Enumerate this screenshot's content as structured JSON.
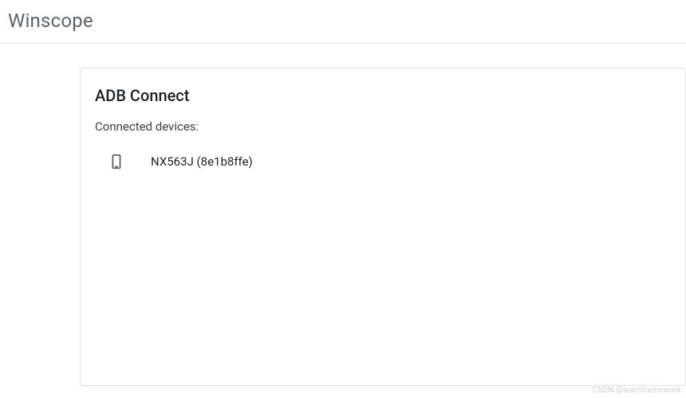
{
  "header": {
    "title": "Winscope"
  },
  "card": {
    "title": "ADB Connect",
    "subtitle": "Connected devices:"
  },
  "devices": [
    {
      "label": "NX563J (8e1b8ffe)"
    }
  ],
  "watermark": "CSDN @learnframework"
}
